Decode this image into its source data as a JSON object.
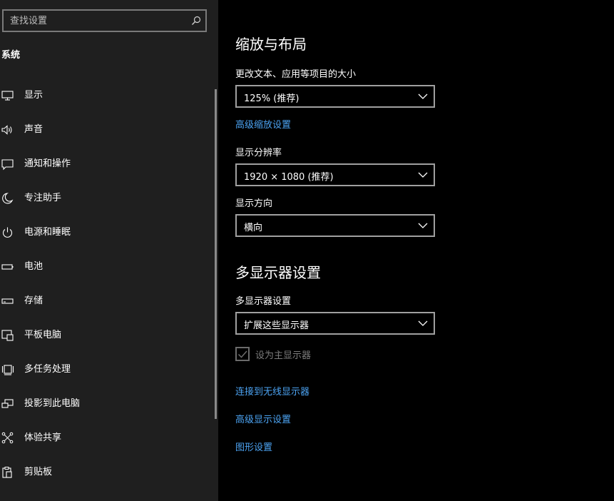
{
  "search": {
    "placeholder": "查找设置"
  },
  "sidebar": {
    "title": "系统",
    "items": [
      {
        "label": "显示",
        "icon": "display-icon"
      },
      {
        "label": "声音",
        "icon": "sound-icon"
      },
      {
        "label": "通知和操作",
        "icon": "notification-icon"
      },
      {
        "label": "专注助手",
        "icon": "moon-icon"
      },
      {
        "label": "电源和睡眠",
        "icon": "power-icon"
      },
      {
        "label": "电池",
        "icon": "battery-icon"
      },
      {
        "label": "存储",
        "icon": "storage-icon"
      },
      {
        "label": "平板电脑",
        "icon": "tablet-icon"
      },
      {
        "label": "多任务处理",
        "icon": "multitask-icon"
      },
      {
        "label": "投影到此电脑",
        "icon": "project-icon"
      },
      {
        "label": "体验共享",
        "icon": "share-icon"
      },
      {
        "label": "剪贴板",
        "icon": "clipboard-icon"
      }
    ]
  },
  "main": {
    "scale_section": {
      "title": "缩放与布局",
      "scale_label": "更改文本、应用等项目的大小",
      "scale_value": "125% (推荐)",
      "advanced_scale_link": "高级缩放设置",
      "resolution_label": "显示分辨率",
      "resolution_value": "1920 × 1080 (推荐)",
      "orientation_label": "显示方向",
      "orientation_value": "横向"
    },
    "multi_section": {
      "title": "多显示器设置",
      "multi_label": "多显示器设置",
      "multi_value": "扩展这些显示器",
      "main_display_checkbox": "设为主显示器",
      "main_display_checked": true,
      "wireless_link": "连接到无线显示器",
      "advanced_display_link": "高级显示设置",
      "graphics_link": "图形设置"
    }
  },
  "colors": {
    "sidebar_bg": "#1f1f1f",
    "main_bg": "#000000",
    "link": "#4ca3f2",
    "disabled_text": "#7d7d7d"
  }
}
